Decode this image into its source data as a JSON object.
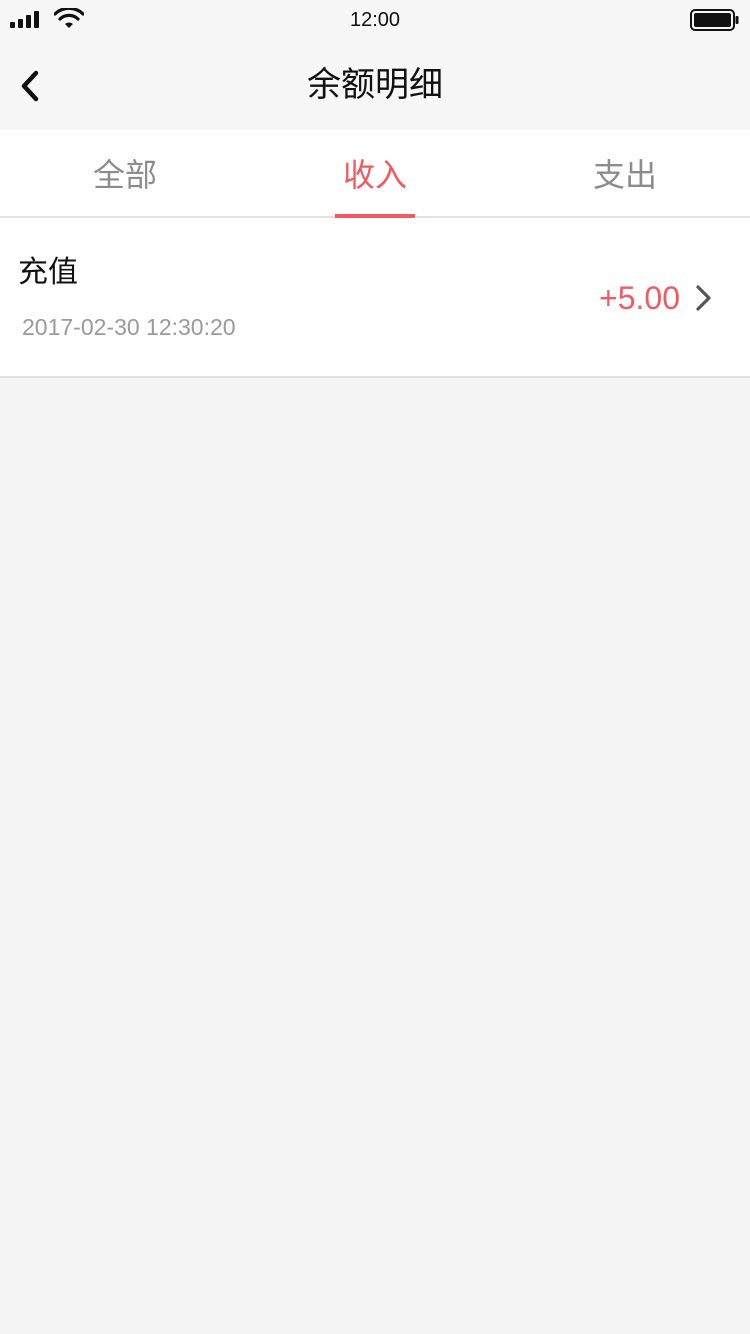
{
  "status_bar": {
    "time": "12:00",
    "icons": [
      "signal-icon",
      "wifi-icon",
      "battery-icon"
    ]
  },
  "nav": {
    "title": "余额明细",
    "back_icon": "chevron-left-icon"
  },
  "tabs": [
    {
      "label": "全部",
      "active": false
    },
    {
      "label": "收入",
      "active": true
    },
    {
      "label": "支出",
      "active": false
    }
  ],
  "records": [
    {
      "title": "充值",
      "time": "2017-02-30 12:30:20",
      "amount": "+5.00",
      "icon": "chevron-right-icon"
    }
  ],
  "colors": {
    "accent": "#f05a62",
    "text_primary": "#111111",
    "text_secondary": "#8c8c8c",
    "background": "#f4f4f4"
  }
}
